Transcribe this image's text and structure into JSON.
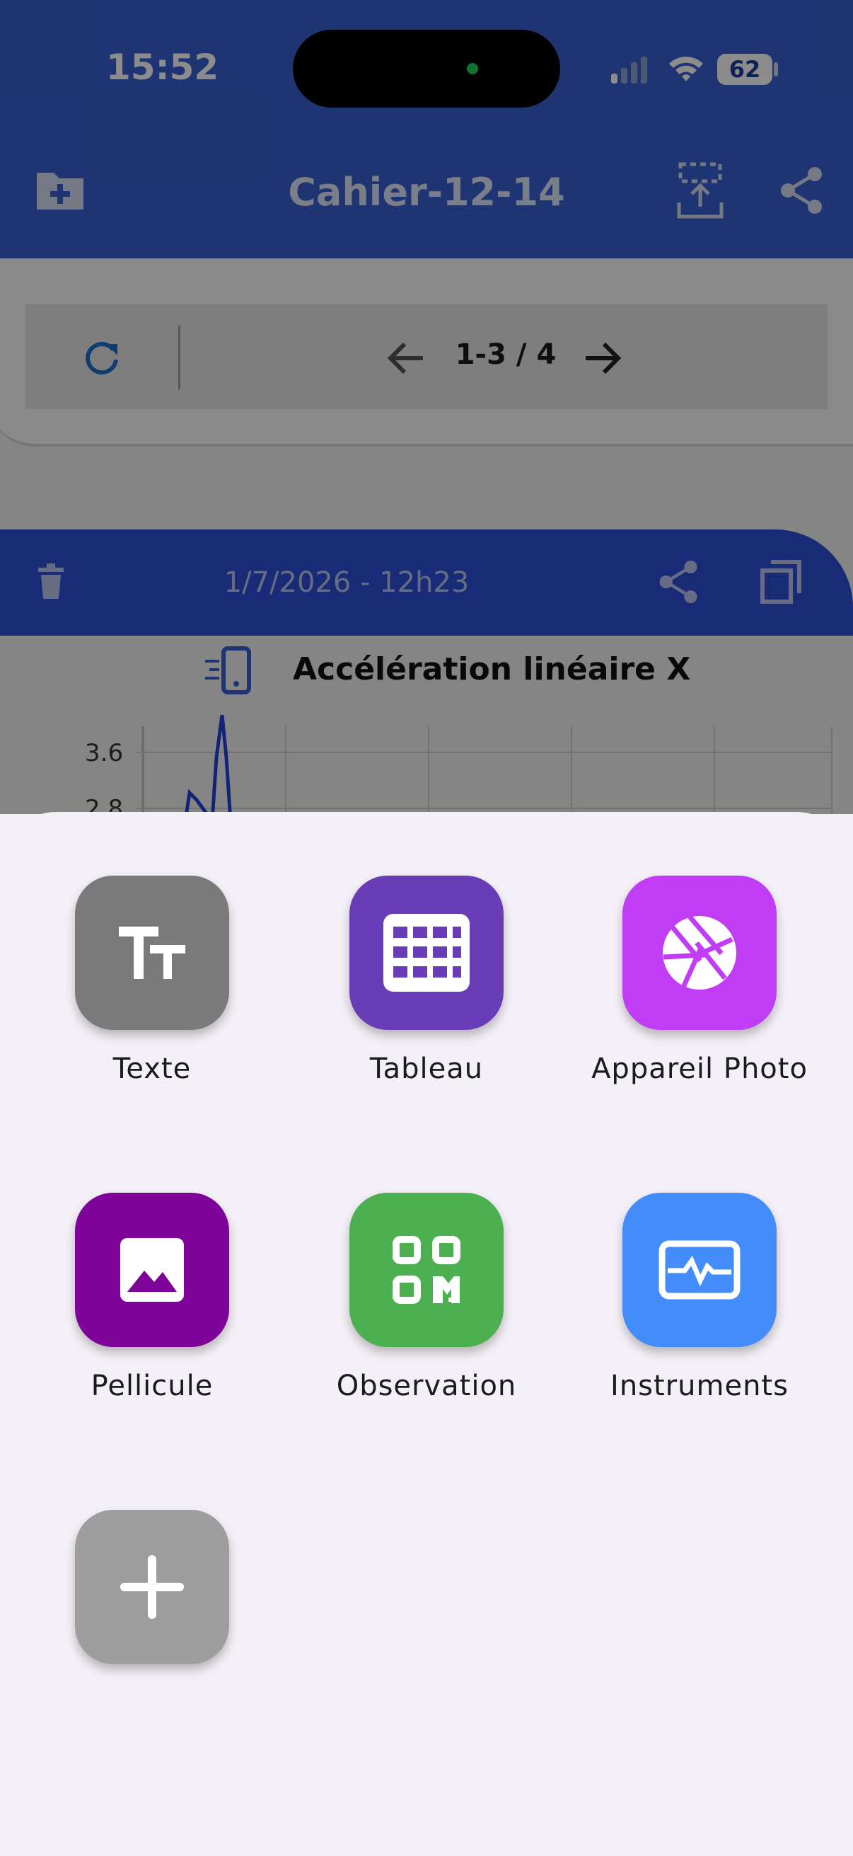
{
  "status_bar": {
    "time": "15:52",
    "battery": "62"
  },
  "app_bar": {
    "title": "Cahier-12-14"
  },
  "pager": {
    "range": "1-3 / 4"
  },
  "note": {
    "date": "1/7/2026 - 12h23",
    "graph_title": "Accélération linéaire X",
    "y_ticks": [
      "3.6",
      "2.8"
    ]
  },
  "sheet": {
    "items": [
      {
        "label": "Texte",
        "icon": "text-size-icon",
        "color": "#7a7a7a"
      },
      {
        "label": "Tableau",
        "icon": "table-grid-icon",
        "color": "#6a3db8"
      },
      {
        "label": "Appareil Photo",
        "icon": "camera-aperture-icon",
        "color": "#c03df5"
      },
      {
        "label": "Pellicule",
        "icon": "image-icon",
        "color": "#7e0499"
      },
      {
        "label": "Observation",
        "icon": "qr-code-icon",
        "color": "#4caf50"
      },
      {
        "label": "Instruments",
        "icon": "monitor-pulse-icon",
        "color": "#428cfc"
      },
      {
        "label": "",
        "icon": "plus-icon",
        "color": "#9e9e9e"
      }
    ]
  }
}
